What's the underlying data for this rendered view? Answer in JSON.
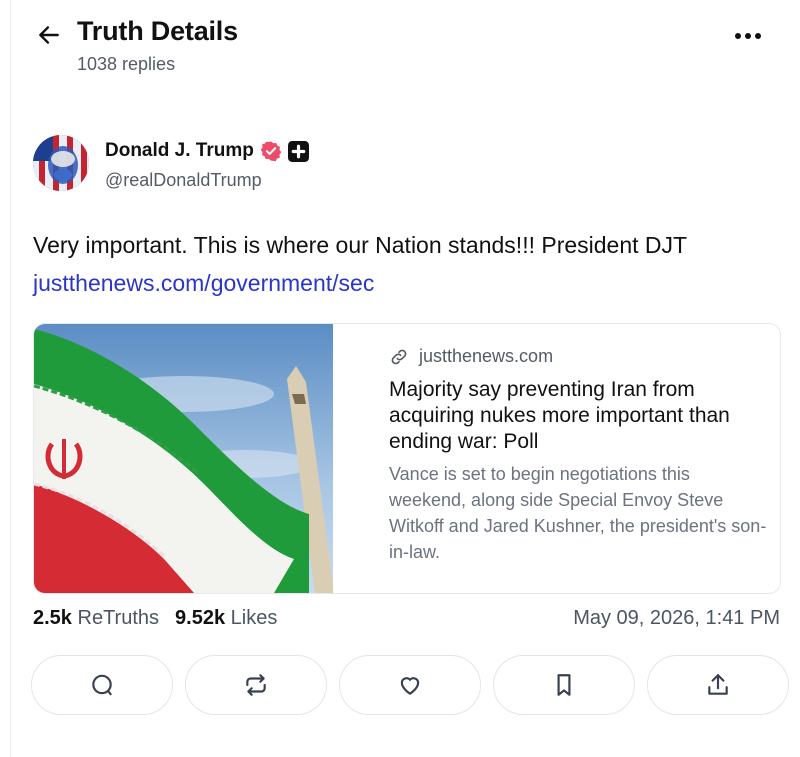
{
  "header": {
    "title": "Truth Details",
    "replies": "1038 replies"
  },
  "author": {
    "name": "Donald J. Trump",
    "handle": "@realDonaldTrump"
  },
  "post": {
    "text": "Very important. This is where our Nation stands!!!  President DJT",
    "link": "justthenews.com/government/sec"
  },
  "card": {
    "domain": "justthenews.com",
    "title": "Majority say preventing Iran from acquiring nukes more important than ending war: Poll",
    "description": "Vance is set to begin negotiations this weekend, along side Special Envoy Steve Witkoff and Jared Kushner, the president's son-in-law."
  },
  "stats": {
    "retruths_count": "2.5k",
    "retruths_label": "ReTruths",
    "likes_count": "9.52k",
    "likes_label": "Likes",
    "timestamp": "May 09, 2026, 1:41 PM"
  },
  "colors": {
    "link": "#2a35c9",
    "verified": "#ee4b6a",
    "text": "#111827",
    "muted": "#555b66"
  },
  "icons": [
    "back-arrow-icon",
    "more-icon",
    "verified-icon",
    "plus-badge-icon",
    "link-icon",
    "reply-icon",
    "retruth-icon",
    "heart-icon",
    "bookmark-icon",
    "share-icon"
  ]
}
